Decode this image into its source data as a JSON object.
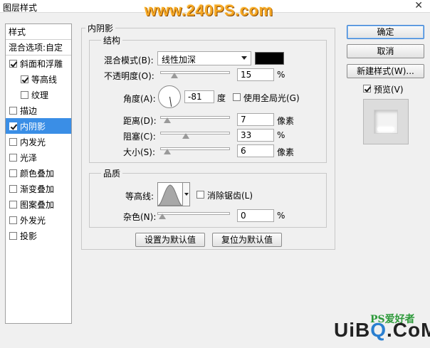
{
  "window": {
    "title": "图层样式",
    "close_glyph": "✕"
  },
  "watermark_top": "www.240PS.com",
  "style_list": {
    "items": [
      {
        "label": "样式",
        "checkbox": false,
        "checked": false,
        "indent": 0,
        "selected": false,
        "header": true
      },
      {
        "label": "混合选项:自定",
        "checkbox": false,
        "checked": false,
        "indent": 0,
        "selected": false,
        "header": true
      },
      {
        "label": "斜面和浮雕",
        "checkbox": true,
        "checked": true,
        "indent": 0,
        "selected": false
      },
      {
        "label": "等高线",
        "checkbox": true,
        "checked": true,
        "indent": 1,
        "selected": false
      },
      {
        "label": "纹理",
        "checkbox": true,
        "checked": false,
        "indent": 1,
        "selected": false
      },
      {
        "label": "描边",
        "checkbox": true,
        "checked": false,
        "indent": 0,
        "selected": false
      },
      {
        "label": "内阴影",
        "checkbox": true,
        "checked": true,
        "indent": 0,
        "selected": true
      },
      {
        "label": "内发光",
        "checkbox": true,
        "checked": false,
        "indent": 0,
        "selected": false
      },
      {
        "label": "光泽",
        "checkbox": true,
        "checked": false,
        "indent": 0,
        "selected": false
      },
      {
        "label": "颜色叠加",
        "checkbox": true,
        "checked": false,
        "indent": 0,
        "selected": false
      },
      {
        "label": "渐变叠加",
        "checkbox": true,
        "checked": false,
        "indent": 0,
        "selected": false
      },
      {
        "label": "图案叠加",
        "checkbox": true,
        "checked": false,
        "indent": 0,
        "selected": false
      },
      {
        "label": "外发光",
        "checkbox": true,
        "checked": false,
        "indent": 0,
        "selected": false
      },
      {
        "label": "投影",
        "checkbox": true,
        "checked": false,
        "indent": 0,
        "selected": false
      }
    ]
  },
  "panel": {
    "title": "内阴影",
    "structure": {
      "title": "结构",
      "blend_mode_label": "混合模式(B):",
      "blend_mode_value": "线性加深",
      "shadow_color": "#000000",
      "opacity_label": "不透明度(O):",
      "opacity_value": "15",
      "opacity_unit": "%",
      "opacity_fraction": 0.15,
      "angle_label": "角度(A):",
      "angle_value": "-81",
      "angle_unit": "度",
      "angle_degrees": -81,
      "global_light_label": "使用全局光(G)",
      "global_light_checked": false,
      "distance_label": "距离(D):",
      "distance_value": "7",
      "distance_unit": "像素",
      "distance_fraction": 0.03,
      "choke_label": "阻塞(C):",
      "choke_value": "33",
      "choke_unit": "%",
      "choke_fraction": 0.33,
      "size_label": "大小(S):",
      "size_value": "6",
      "size_unit": "像素",
      "size_fraction": 0.03
    },
    "quality": {
      "title": "品质",
      "contour_label": "等高线:",
      "antialias_label": "消除锯齿(L)",
      "antialias_checked": false,
      "noise_label": "杂色(N):",
      "noise_value": "0",
      "noise_unit": "%",
      "noise_fraction": 0.0
    },
    "set_default_label": "设置为默认值",
    "reset_default_label": "复位为默认值"
  },
  "actions": {
    "ok_label": "确定",
    "cancel_label": "取消",
    "new_style_label": "新建样式(W)...",
    "preview_label": "预览(V)",
    "preview_checked": true
  },
  "footer_brand": {
    "ps": "PS爱好者",
    "site_a": "UiB",
    "site_q": "Q",
    "site_b": ".CoM"
  }
}
